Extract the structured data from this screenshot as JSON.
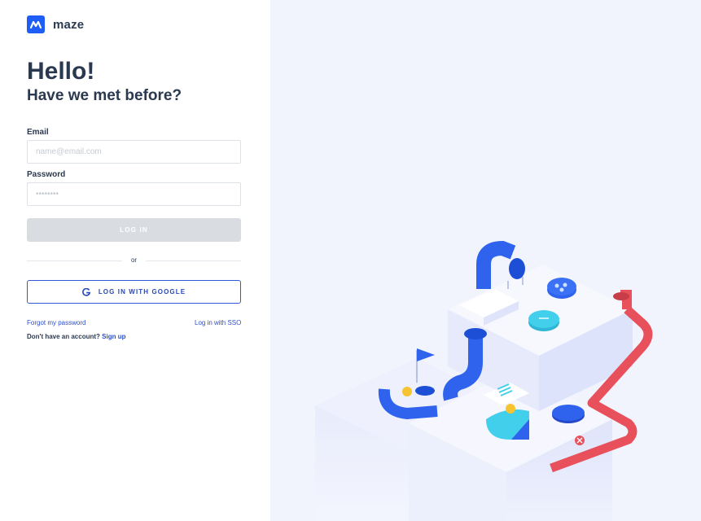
{
  "brand": {
    "name": "maze",
    "color": "#1e5ef6"
  },
  "header": {
    "title": "Hello!",
    "subtitle": "Have we met before?"
  },
  "form": {
    "email_label": "Email",
    "email_placeholder": "name@email.com",
    "email_value": "",
    "password_label": "Password",
    "password_placeholder": "••••••••",
    "password_value": "",
    "login_button": "LOG IN",
    "divider_text": "or",
    "google_button": "LOG IN WITH GOOGLE"
  },
  "links": {
    "forgot_password": "Forgot my password",
    "sso": "Log in with SSO",
    "no_account": "Don't have an account?",
    "sign_up": "Sign up"
  },
  "illustration": {
    "icon": "isometric-maze-illustration"
  },
  "colors": {
    "accent": "#1e5ef6",
    "heading": "#2b3950",
    "link": "#2d4fc9",
    "disabled": "#d9dce1",
    "panel": "#f2f4fd",
    "pipe": "#e8505b",
    "cyan": "#3fcbe8"
  }
}
